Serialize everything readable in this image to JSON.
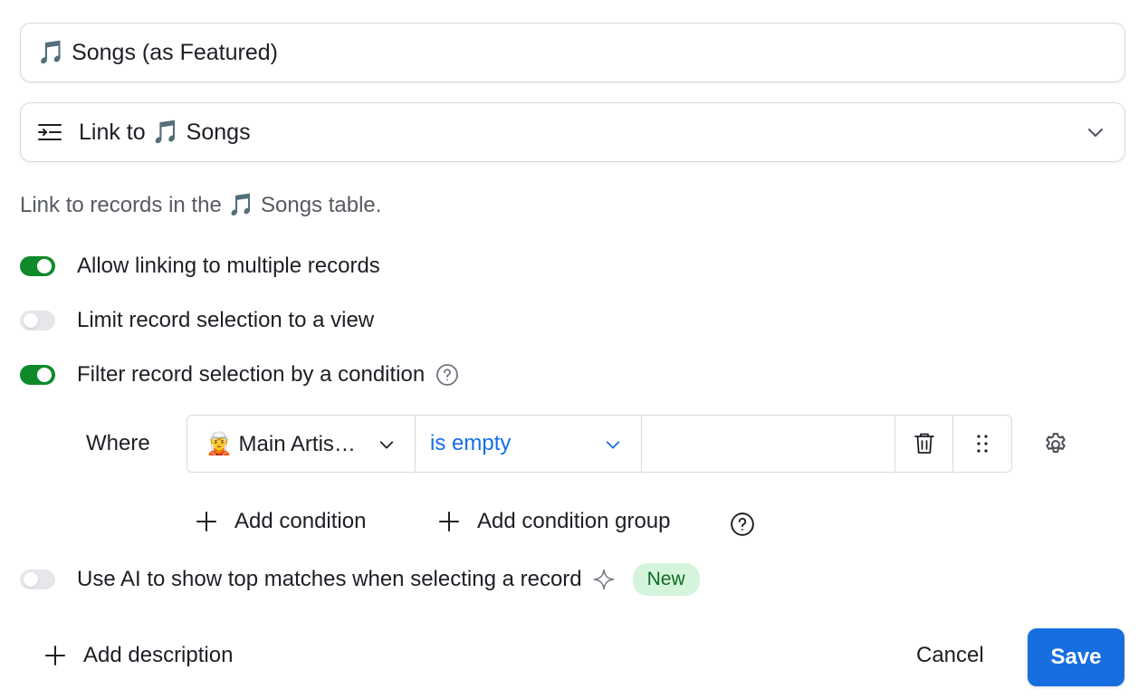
{
  "field_name": {
    "value": "🎵 Songs (as Featured)"
  },
  "field_type": {
    "label": "Link to 🎵 Songs",
    "icon": "link-field-icon"
  },
  "description": "Link to records in the 🎵 Songs table.",
  "options": [
    {
      "label": "Allow linking to multiple records",
      "enabled": true
    },
    {
      "label": "Limit record selection to a view",
      "enabled": false
    },
    {
      "label": "Filter record selection by a condition",
      "enabled": true
    }
  ],
  "condition": {
    "where_label": "Where",
    "field": "🧝 Main Artis…",
    "operator": "is empty",
    "value": ""
  },
  "add_condition": "Add condition",
  "add_condition_group": "Add condition group",
  "ai_option": {
    "label": "Use AI to show top matches when selecting a record",
    "enabled": false,
    "badge": "New"
  },
  "footer": {
    "add_description": "Add description",
    "cancel": "Cancel",
    "save": "Save"
  },
  "colors": {
    "accent": "#166ee1",
    "toggle_on": "#0f8a2a",
    "badge_bg": "#d4f5dc",
    "badge_text": "#0e6a22"
  }
}
